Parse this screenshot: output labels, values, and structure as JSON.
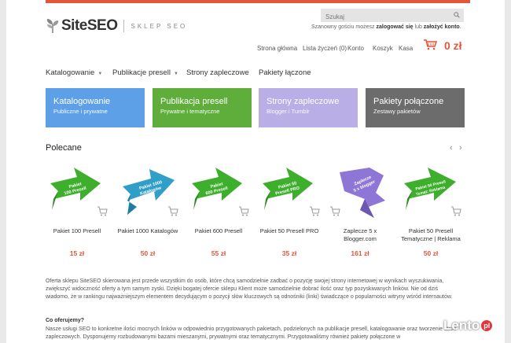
{
  "header": {
    "logo_text": "SiteSEO",
    "logo_sub": "SKLEP SEO",
    "search_placeholder": "Szukaj",
    "greeting_prefix": "Szanowny gościu możesz ",
    "greeting_login": "zalogować się",
    "greeting_mid": " lub ",
    "greeting_register": "założyć konto",
    "greeting_suffix": ".",
    "links": [
      "Strona główna",
      "Lista życzeń (0)",
      "Konto",
      "Koszyk",
      "Kasa"
    ],
    "cart_total": "0 zł"
  },
  "menu": {
    "items": [
      "Katalogowanie",
      "Publikacje presell",
      "Strony zapleczowe",
      "Pakiety łączone"
    ]
  },
  "tiles": [
    {
      "title": "Katalogowanie",
      "subtitle": "Publiczne i prywatne",
      "color": "#5ea0e8"
    },
    {
      "title": "Publikacja presell",
      "subtitle": "Prywatne i tematyczne",
      "color": "#5fae3b"
    },
    {
      "title": "Strony zapleczowe",
      "subtitle": "Blogger i Tumblr",
      "color": "#b9aee6"
    },
    {
      "title": "Pakiety połączone",
      "subtitle": "Zestawy pakietów",
      "color": "#6c6c6c"
    }
  ],
  "section": {
    "title": "Polecane",
    "prev": "‹",
    "next": "›"
  },
  "products": [
    {
      "name": "Pakiet 100 Presell",
      "price": "15 zł",
      "ribbon": [
        "Pakiet",
        "100 Presell"
      ],
      "color": "#3daf2c"
    },
    {
      "name": "Pakiet 1000 Katalogów",
      "price": "50 zł",
      "ribbon": [
        "Pakiet 1000",
        "Katalogów"
      ],
      "color": "#2f9fc9"
    },
    {
      "name": "Pakiet 600 Presell",
      "price": "55 zł",
      "ribbon": [
        "Pakiet",
        "600 Presell"
      ],
      "color": "#3daf2c"
    },
    {
      "name": "Pakiet 50 Presell PRO",
      "price": "35 zł",
      "ribbon": [
        "Pakiet 50",
        "Presell PRO"
      ],
      "color": "#3daf2c"
    },
    {
      "name": "Zaplecze 5 x Blogger.com",
      "name_line1": "Zaplecze 5 x",
      "name_line2": "Blogger.com",
      "price": "161 zł",
      "ribbon": [
        "Zaplecze",
        "5 x blogger"
      ],
      "color": "#8e76d6"
    },
    {
      "name": "Pakiet 50 Presell Tematyczne | Reklama",
      "name_line1": "Pakiet 50 Presell",
      "name_line2": "Tematyczne | Reklama",
      "price": "50 zł",
      "ribbon": [
        "Pakiet 50 Presell",
        "Temat: Reklama"
      ],
      "color": "#3daf2c"
    }
  ],
  "description": {
    "p1": "Oferta sklepu SiteSEO skierowana jest przede wszystkim do osób, które chcą samodzielnie zadbać o pozycję swojej strony internetowej w wynikach wyszukiwania, zwiększyć widoczność oferty a tym samym zyski. Dzięki bogatej ofercie sklepu Klient może samodzielnie dobrać ilość oraz typ pozyskiwanych linków. Nie od dziś wiadomo, że w rankingu najważniejszym elementem decydującym o pozycji słów kluczowych są odnośniki (linki) świadczące o popularności witryny wśród internautów.",
    "heading": "Co oferujemy?",
    "p2": "Nasze usługi SEO to konkretne ilości mocnych linków w odpowiednio przygotowanych pakietach, podzielonych na publikacje presell, katalogowanie oraz tworzenie stron zapleczowych. Dysponujemy rozbudowanymi bazami mieszanymi, prywatnymi oraz tematycznymi. Przygotowaliśmy również pakiety połączone w"
  },
  "watermark": {
    "text": "Lento",
    "badge": "pl"
  }
}
